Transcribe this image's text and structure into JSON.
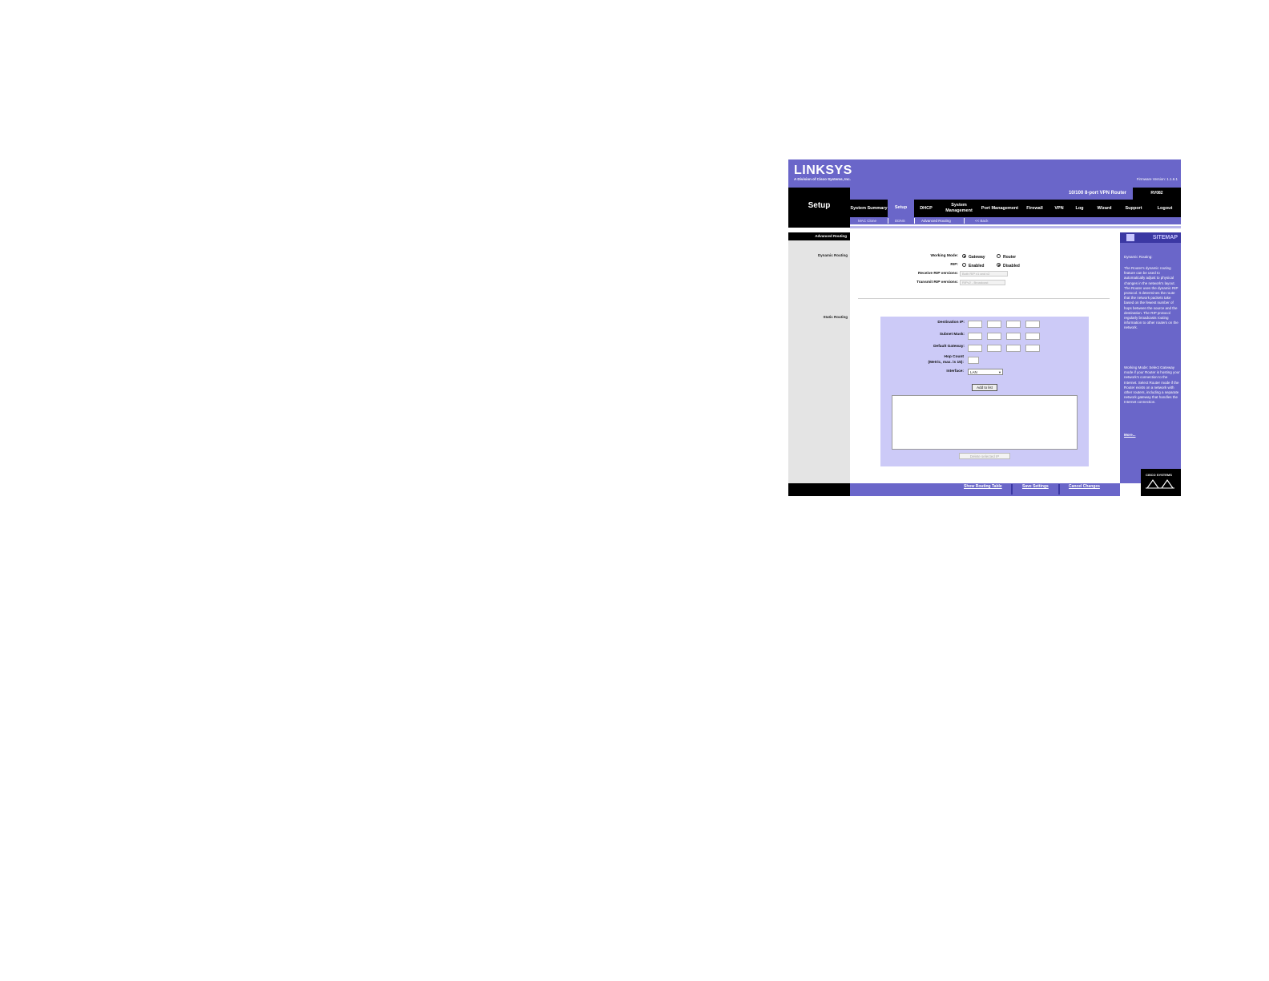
{
  "header": {
    "logo": "LINKSYS",
    "logo_sub": "A Division of Cisco Systems, Inc.",
    "firmware": "Firmware Version: 1.1.6.1",
    "product": "10/100 8-port VPN Router",
    "model": "RV082",
    "section_title": "Setup"
  },
  "nav": {
    "items": [
      {
        "label": "System Summary"
      },
      {
        "label": "Setup"
      },
      {
        "label": "DHCP"
      },
      {
        "label": "System Management"
      },
      {
        "label": "Port Management"
      },
      {
        "label": "Firewall"
      },
      {
        "label": "VPN"
      },
      {
        "label": "Log"
      },
      {
        "label": "Wizard"
      },
      {
        "label": "Support"
      },
      {
        "label": "Logout"
      }
    ],
    "active": "Setup"
  },
  "subnav": {
    "mac_clone": "MAC Clone",
    "ddns": "DDNS",
    "advanced_routing": "Advanced Routing",
    "back": "<< Back"
  },
  "left": {
    "section_header": "Advanced Routing",
    "dynamic_routing": "Dynamic Routing",
    "static_routing": "Static Routing"
  },
  "dynamic": {
    "working_mode_label": "Working Mode:",
    "gateway": "Gateway",
    "router": "Router",
    "working_mode_value": "Gateway",
    "rip_label": "RIP:",
    "enabled": "Enabled",
    "disabled": "Disabled",
    "rip_value": "Disabled",
    "receive_label": "Receive RIP versions:",
    "receive_value": "Both RIP v1 and v2",
    "transmit_label": "Transmit RIP versions:",
    "transmit_value": "RIPv2 - Broadcast"
  },
  "static": {
    "destination_ip_label": "Destination IP:",
    "subnet_mask_label": "Subnet Mask:",
    "default_gateway_label": "Default Gateway:",
    "hop_count_label": "Hop Count",
    "hop_count_sub": "(Metric, max. is 15):",
    "interface_label": "Interface:",
    "interface_value": "LAN",
    "add_button": "Add to list",
    "delete_button": "Delete selected IP"
  },
  "sitemap": {
    "title": "SITEMAP",
    "help_title": "Dynamic Routing:",
    "help_body": "The Router's dynamic routing feature can be used to automatically adjust to physical changes in the network's layout. The Router uses the dynamic RIP protocol. It determines the route that the network packets take based on the fewest number of hops between the source and the destination. The RIP protocol regularly broadcasts routing information to other routers on the network.",
    "help_mode": "Working Mode: Select Gateway mode if your Router is hosting your network's connection to the Internet. Select Router mode if the Router exists on a network with other routers, including a separate network gateway that handles the Internet connection.",
    "more": "More...",
    "cisco": "CISCO SYSTEMS"
  },
  "footer": {
    "show_routing_table": "Show Routing Table",
    "save_settings": "Save Settings",
    "cancel_changes": "Cancel Changes"
  },
  "colors": {
    "brand_purple": "#6a66c9",
    "dark_purple": "#3b38a3",
    "panel_lilac": "#cccaf7"
  }
}
